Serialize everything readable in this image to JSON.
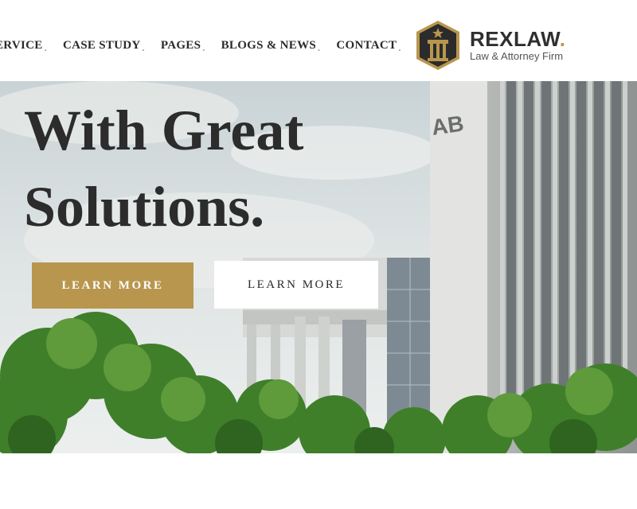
{
  "nav": {
    "items": [
      {
        "label": "ERVICE"
      },
      {
        "label": "CASE STUDY"
      },
      {
        "label": "PAGES"
      },
      {
        "label": "BLOGS & NEWS"
      },
      {
        "label": "CONTACT"
      }
    ],
    "dot": "."
  },
  "logo": {
    "name": "REXLAW",
    "name_dot": ".",
    "subtitle": "Law & Attorney Firm"
  },
  "hero": {
    "headline_line1": "With Great",
    "headline_line2": "Solutions.",
    "building_sign": "AB",
    "primary_button": "LEARN MORE",
    "secondary_button": "LEARN MORE"
  },
  "colors": {
    "accent": "#b8964e",
    "heading": "#2c2c2c",
    "logo_dark": "#2f2f2f"
  }
}
